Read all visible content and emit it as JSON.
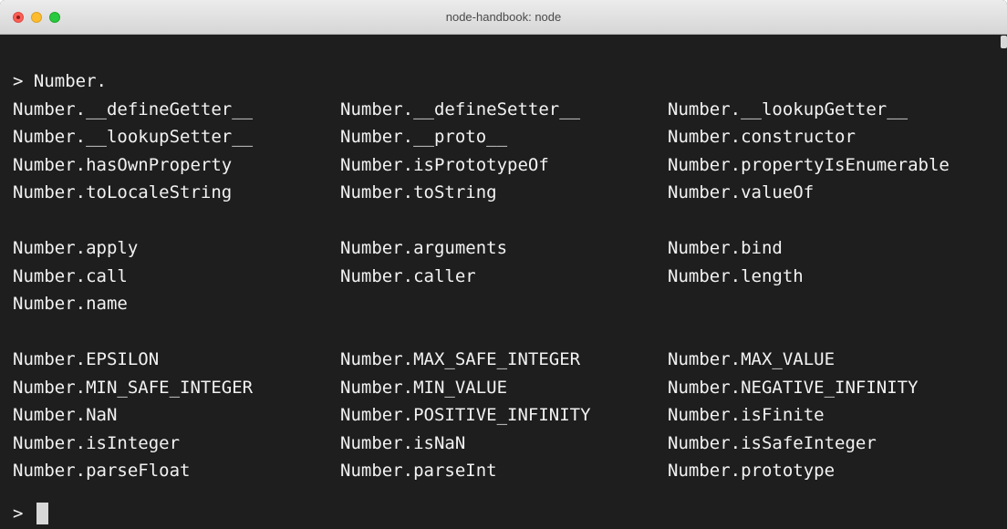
{
  "window": {
    "title": "node-handbook: node"
  },
  "terminal": {
    "prompt_symbol": ">",
    "input": "Number.",
    "groups": [
      [
        [
          "Number.__defineGetter__",
          "Number.__defineSetter__",
          "Number.__lookupGetter__"
        ],
        [
          "Number.__lookupSetter__",
          "Number.__proto__",
          "Number.constructor"
        ],
        [
          "Number.hasOwnProperty",
          "Number.isPrototypeOf",
          "Number.propertyIsEnumerable"
        ],
        [
          "Number.toLocaleString",
          "Number.toString",
          "Number.valueOf"
        ]
      ],
      [
        [
          "Number.apply",
          "Number.arguments",
          "Number.bind"
        ],
        [
          "Number.call",
          "Number.caller",
          "Number.length"
        ],
        [
          "Number.name",
          "",
          ""
        ]
      ],
      [
        [
          "Number.EPSILON",
          "Number.MAX_SAFE_INTEGER",
          "Number.MAX_VALUE"
        ],
        [
          "Number.MIN_SAFE_INTEGER",
          "Number.MIN_VALUE",
          "Number.NEGATIVE_INFINITY"
        ],
        [
          "Number.NaN",
          "Number.POSITIVE_INFINITY",
          "Number.isFinite"
        ],
        [
          "Number.isInteger",
          "Number.isNaN",
          "Number.isSafeInteger"
        ],
        [
          "Number.parseFloat",
          "Number.parseInt",
          "Number.prototype"
        ]
      ]
    ],
    "final_prompt": ">"
  }
}
